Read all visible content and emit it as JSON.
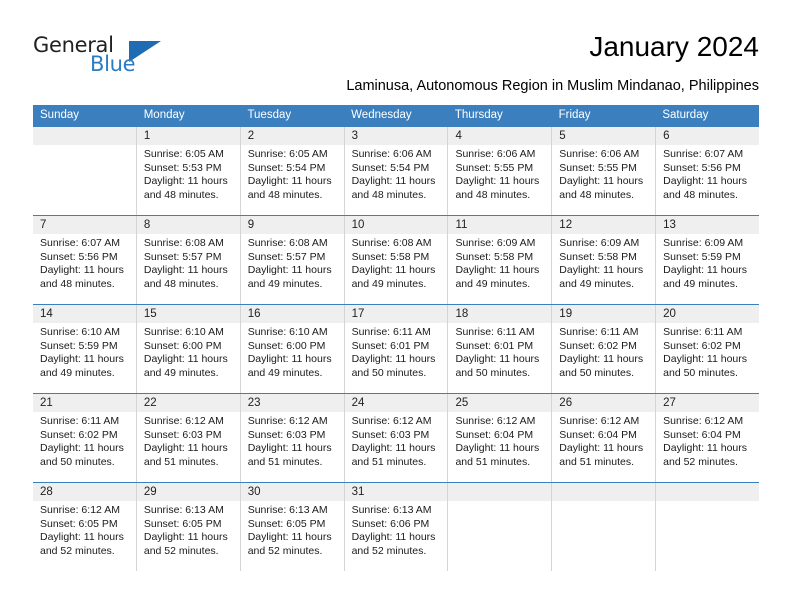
{
  "brand": {
    "word_one": "General",
    "word_two": "Blue",
    "triangle_icon": "triangle-icon",
    "accent_color": "#1f6cb4",
    "text_color": "#231f20"
  },
  "header": {
    "title": "January 2024",
    "subtitle": "Laminusa, Autonomous Region in Muslim Mindanao, Philippines"
  },
  "calendar": {
    "header_bg": "#3c7fbf",
    "daynumber_bg": "#efefef",
    "weekdays": [
      "Sunday",
      "Monday",
      "Tuesday",
      "Wednesday",
      "Thursday",
      "Friday",
      "Saturday"
    ],
    "labels": {
      "sunrise": "Sunrise:",
      "sunset": "Sunset:",
      "daylight": "Daylight:"
    },
    "weeks": [
      [
        {
          "day": "",
          "sunrise": "",
          "sunset": "",
          "daylight_l1": "",
          "daylight_l2": ""
        },
        {
          "day": "1",
          "sunrise": "Sunrise: 6:05 AM",
          "sunset": "Sunset: 5:53 PM",
          "daylight_l1": "Daylight: 11 hours",
          "daylight_l2": "and 48 minutes."
        },
        {
          "day": "2",
          "sunrise": "Sunrise: 6:05 AM",
          "sunset": "Sunset: 5:54 PM",
          "daylight_l1": "Daylight: 11 hours",
          "daylight_l2": "and 48 minutes."
        },
        {
          "day": "3",
          "sunrise": "Sunrise: 6:06 AM",
          "sunset": "Sunset: 5:54 PM",
          "daylight_l1": "Daylight: 11 hours",
          "daylight_l2": "and 48 minutes."
        },
        {
          "day": "4",
          "sunrise": "Sunrise: 6:06 AM",
          "sunset": "Sunset: 5:55 PM",
          "daylight_l1": "Daylight: 11 hours",
          "daylight_l2": "and 48 minutes."
        },
        {
          "day": "5",
          "sunrise": "Sunrise: 6:06 AM",
          "sunset": "Sunset: 5:55 PM",
          "daylight_l1": "Daylight: 11 hours",
          "daylight_l2": "and 48 minutes."
        },
        {
          "day": "6",
          "sunrise": "Sunrise: 6:07 AM",
          "sunset": "Sunset: 5:56 PM",
          "daylight_l1": "Daylight: 11 hours",
          "daylight_l2": "and 48 minutes."
        }
      ],
      [
        {
          "day": "7",
          "sunrise": "Sunrise: 6:07 AM",
          "sunset": "Sunset: 5:56 PM",
          "daylight_l1": "Daylight: 11 hours",
          "daylight_l2": "and 48 minutes."
        },
        {
          "day": "8",
          "sunrise": "Sunrise: 6:08 AM",
          "sunset": "Sunset: 5:57 PM",
          "daylight_l1": "Daylight: 11 hours",
          "daylight_l2": "and 48 minutes."
        },
        {
          "day": "9",
          "sunrise": "Sunrise: 6:08 AM",
          "sunset": "Sunset: 5:57 PM",
          "daylight_l1": "Daylight: 11 hours",
          "daylight_l2": "and 49 minutes."
        },
        {
          "day": "10",
          "sunrise": "Sunrise: 6:08 AM",
          "sunset": "Sunset: 5:58 PM",
          "daylight_l1": "Daylight: 11 hours",
          "daylight_l2": "and 49 minutes."
        },
        {
          "day": "11",
          "sunrise": "Sunrise: 6:09 AM",
          "sunset": "Sunset: 5:58 PM",
          "daylight_l1": "Daylight: 11 hours",
          "daylight_l2": "and 49 minutes."
        },
        {
          "day": "12",
          "sunrise": "Sunrise: 6:09 AM",
          "sunset": "Sunset: 5:58 PM",
          "daylight_l1": "Daylight: 11 hours",
          "daylight_l2": "and 49 minutes."
        },
        {
          "day": "13",
          "sunrise": "Sunrise: 6:09 AM",
          "sunset": "Sunset: 5:59 PM",
          "daylight_l1": "Daylight: 11 hours",
          "daylight_l2": "and 49 minutes."
        }
      ],
      [
        {
          "day": "14",
          "sunrise": "Sunrise: 6:10 AM",
          "sunset": "Sunset: 5:59 PM",
          "daylight_l1": "Daylight: 11 hours",
          "daylight_l2": "and 49 minutes."
        },
        {
          "day": "15",
          "sunrise": "Sunrise: 6:10 AM",
          "sunset": "Sunset: 6:00 PM",
          "daylight_l1": "Daylight: 11 hours",
          "daylight_l2": "and 49 minutes."
        },
        {
          "day": "16",
          "sunrise": "Sunrise: 6:10 AM",
          "sunset": "Sunset: 6:00 PM",
          "daylight_l1": "Daylight: 11 hours",
          "daylight_l2": "and 49 minutes."
        },
        {
          "day": "17",
          "sunrise": "Sunrise: 6:11 AM",
          "sunset": "Sunset: 6:01 PM",
          "daylight_l1": "Daylight: 11 hours",
          "daylight_l2": "and 50 minutes."
        },
        {
          "day": "18",
          "sunrise": "Sunrise: 6:11 AM",
          "sunset": "Sunset: 6:01 PM",
          "daylight_l1": "Daylight: 11 hours",
          "daylight_l2": "and 50 minutes."
        },
        {
          "day": "19",
          "sunrise": "Sunrise: 6:11 AM",
          "sunset": "Sunset: 6:02 PM",
          "daylight_l1": "Daylight: 11 hours",
          "daylight_l2": "and 50 minutes."
        },
        {
          "day": "20",
          "sunrise": "Sunrise: 6:11 AM",
          "sunset": "Sunset: 6:02 PM",
          "daylight_l1": "Daylight: 11 hours",
          "daylight_l2": "and 50 minutes."
        }
      ],
      [
        {
          "day": "21",
          "sunrise": "Sunrise: 6:11 AM",
          "sunset": "Sunset: 6:02 PM",
          "daylight_l1": "Daylight: 11 hours",
          "daylight_l2": "and 50 minutes."
        },
        {
          "day": "22",
          "sunrise": "Sunrise: 6:12 AM",
          "sunset": "Sunset: 6:03 PM",
          "daylight_l1": "Daylight: 11 hours",
          "daylight_l2": "and 51 minutes."
        },
        {
          "day": "23",
          "sunrise": "Sunrise: 6:12 AM",
          "sunset": "Sunset: 6:03 PM",
          "daylight_l1": "Daylight: 11 hours",
          "daylight_l2": "and 51 minutes."
        },
        {
          "day": "24",
          "sunrise": "Sunrise: 6:12 AM",
          "sunset": "Sunset: 6:03 PM",
          "daylight_l1": "Daylight: 11 hours",
          "daylight_l2": "and 51 minutes."
        },
        {
          "day": "25",
          "sunrise": "Sunrise: 6:12 AM",
          "sunset": "Sunset: 6:04 PM",
          "daylight_l1": "Daylight: 11 hours",
          "daylight_l2": "and 51 minutes."
        },
        {
          "day": "26",
          "sunrise": "Sunrise: 6:12 AM",
          "sunset": "Sunset: 6:04 PM",
          "daylight_l1": "Daylight: 11 hours",
          "daylight_l2": "and 51 minutes."
        },
        {
          "day": "27",
          "sunrise": "Sunrise: 6:12 AM",
          "sunset": "Sunset: 6:04 PM",
          "daylight_l1": "Daylight: 11 hours",
          "daylight_l2": "and 52 minutes."
        }
      ],
      [
        {
          "day": "28",
          "sunrise": "Sunrise: 6:12 AM",
          "sunset": "Sunset: 6:05 PM",
          "daylight_l1": "Daylight: 11 hours",
          "daylight_l2": "and 52 minutes."
        },
        {
          "day": "29",
          "sunrise": "Sunrise: 6:13 AM",
          "sunset": "Sunset: 6:05 PM",
          "daylight_l1": "Daylight: 11 hours",
          "daylight_l2": "and 52 minutes."
        },
        {
          "day": "30",
          "sunrise": "Sunrise: 6:13 AM",
          "sunset": "Sunset: 6:05 PM",
          "daylight_l1": "Daylight: 11 hours",
          "daylight_l2": "and 52 minutes."
        },
        {
          "day": "31",
          "sunrise": "Sunrise: 6:13 AM",
          "sunset": "Sunset: 6:06 PM",
          "daylight_l1": "Daylight: 11 hours",
          "daylight_l2": "and 52 minutes."
        },
        {
          "day": "",
          "sunrise": "",
          "sunset": "",
          "daylight_l1": "",
          "daylight_l2": ""
        },
        {
          "day": "",
          "sunrise": "",
          "sunset": "",
          "daylight_l1": "",
          "daylight_l2": ""
        },
        {
          "day": "",
          "sunrise": "",
          "sunset": "",
          "daylight_l1": "",
          "daylight_l2": ""
        }
      ]
    ]
  }
}
